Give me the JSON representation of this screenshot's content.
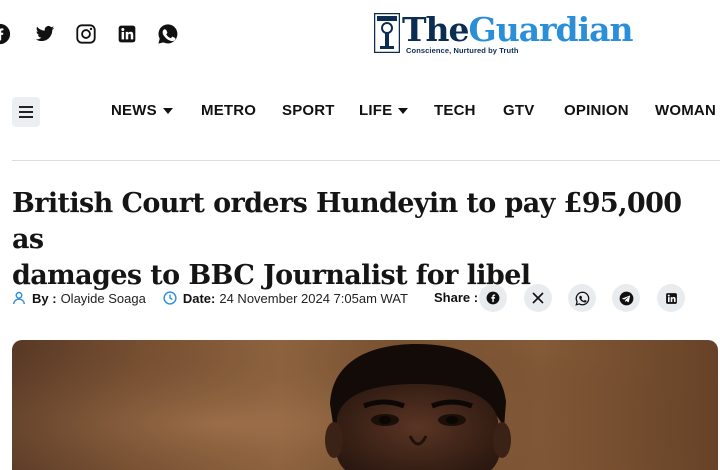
{
  "header": {
    "social_icons": [
      "facebook-icon",
      "twitter-icon",
      "instagram-icon",
      "linkedin-icon",
      "whatsapp-icon"
    ],
    "logo": {
      "the": "The",
      "name": "Guardian",
      "tagline": "Conscience, Nurtured by Truth"
    }
  },
  "nav": {
    "items": [
      {
        "label": "NEWS",
        "dropdown": true
      },
      {
        "label": "METRO",
        "dropdown": false
      },
      {
        "label": "SPORT",
        "dropdown": false
      },
      {
        "label": "LIFE",
        "dropdown": true
      },
      {
        "label": "TECH",
        "dropdown": false
      },
      {
        "label": "GTV",
        "dropdown": false
      },
      {
        "label": "OPINION",
        "dropdown": false
      },
      {
        "label": "WOMAN",
        "dropdown": false
      }
    ]
  },
  "article": {
    "title_line1": "British Court orders Hundeyin to pay £95,000 as",
    "title_line2": "damages to BBC Journalist for libel",
    "by_label": "By :",
    "author": "Olayide Soaga",
    "date_label": "Date:",
    "date": "24 November 2024 7:05am WAT",
    "share_label": "Share :",
    "share_icons": [
      "facebook-icon",
      "x-icon",
      "whatsapp-icon",
      "telegram-icon",
      "linkedin-icon"
    ]
  },
  "colors": {
    "brand_dark": "#0c2d52",
    "brand_blue": "#2a8fd8",
    "meta_icon": "#2a8fd8"
  }
}
